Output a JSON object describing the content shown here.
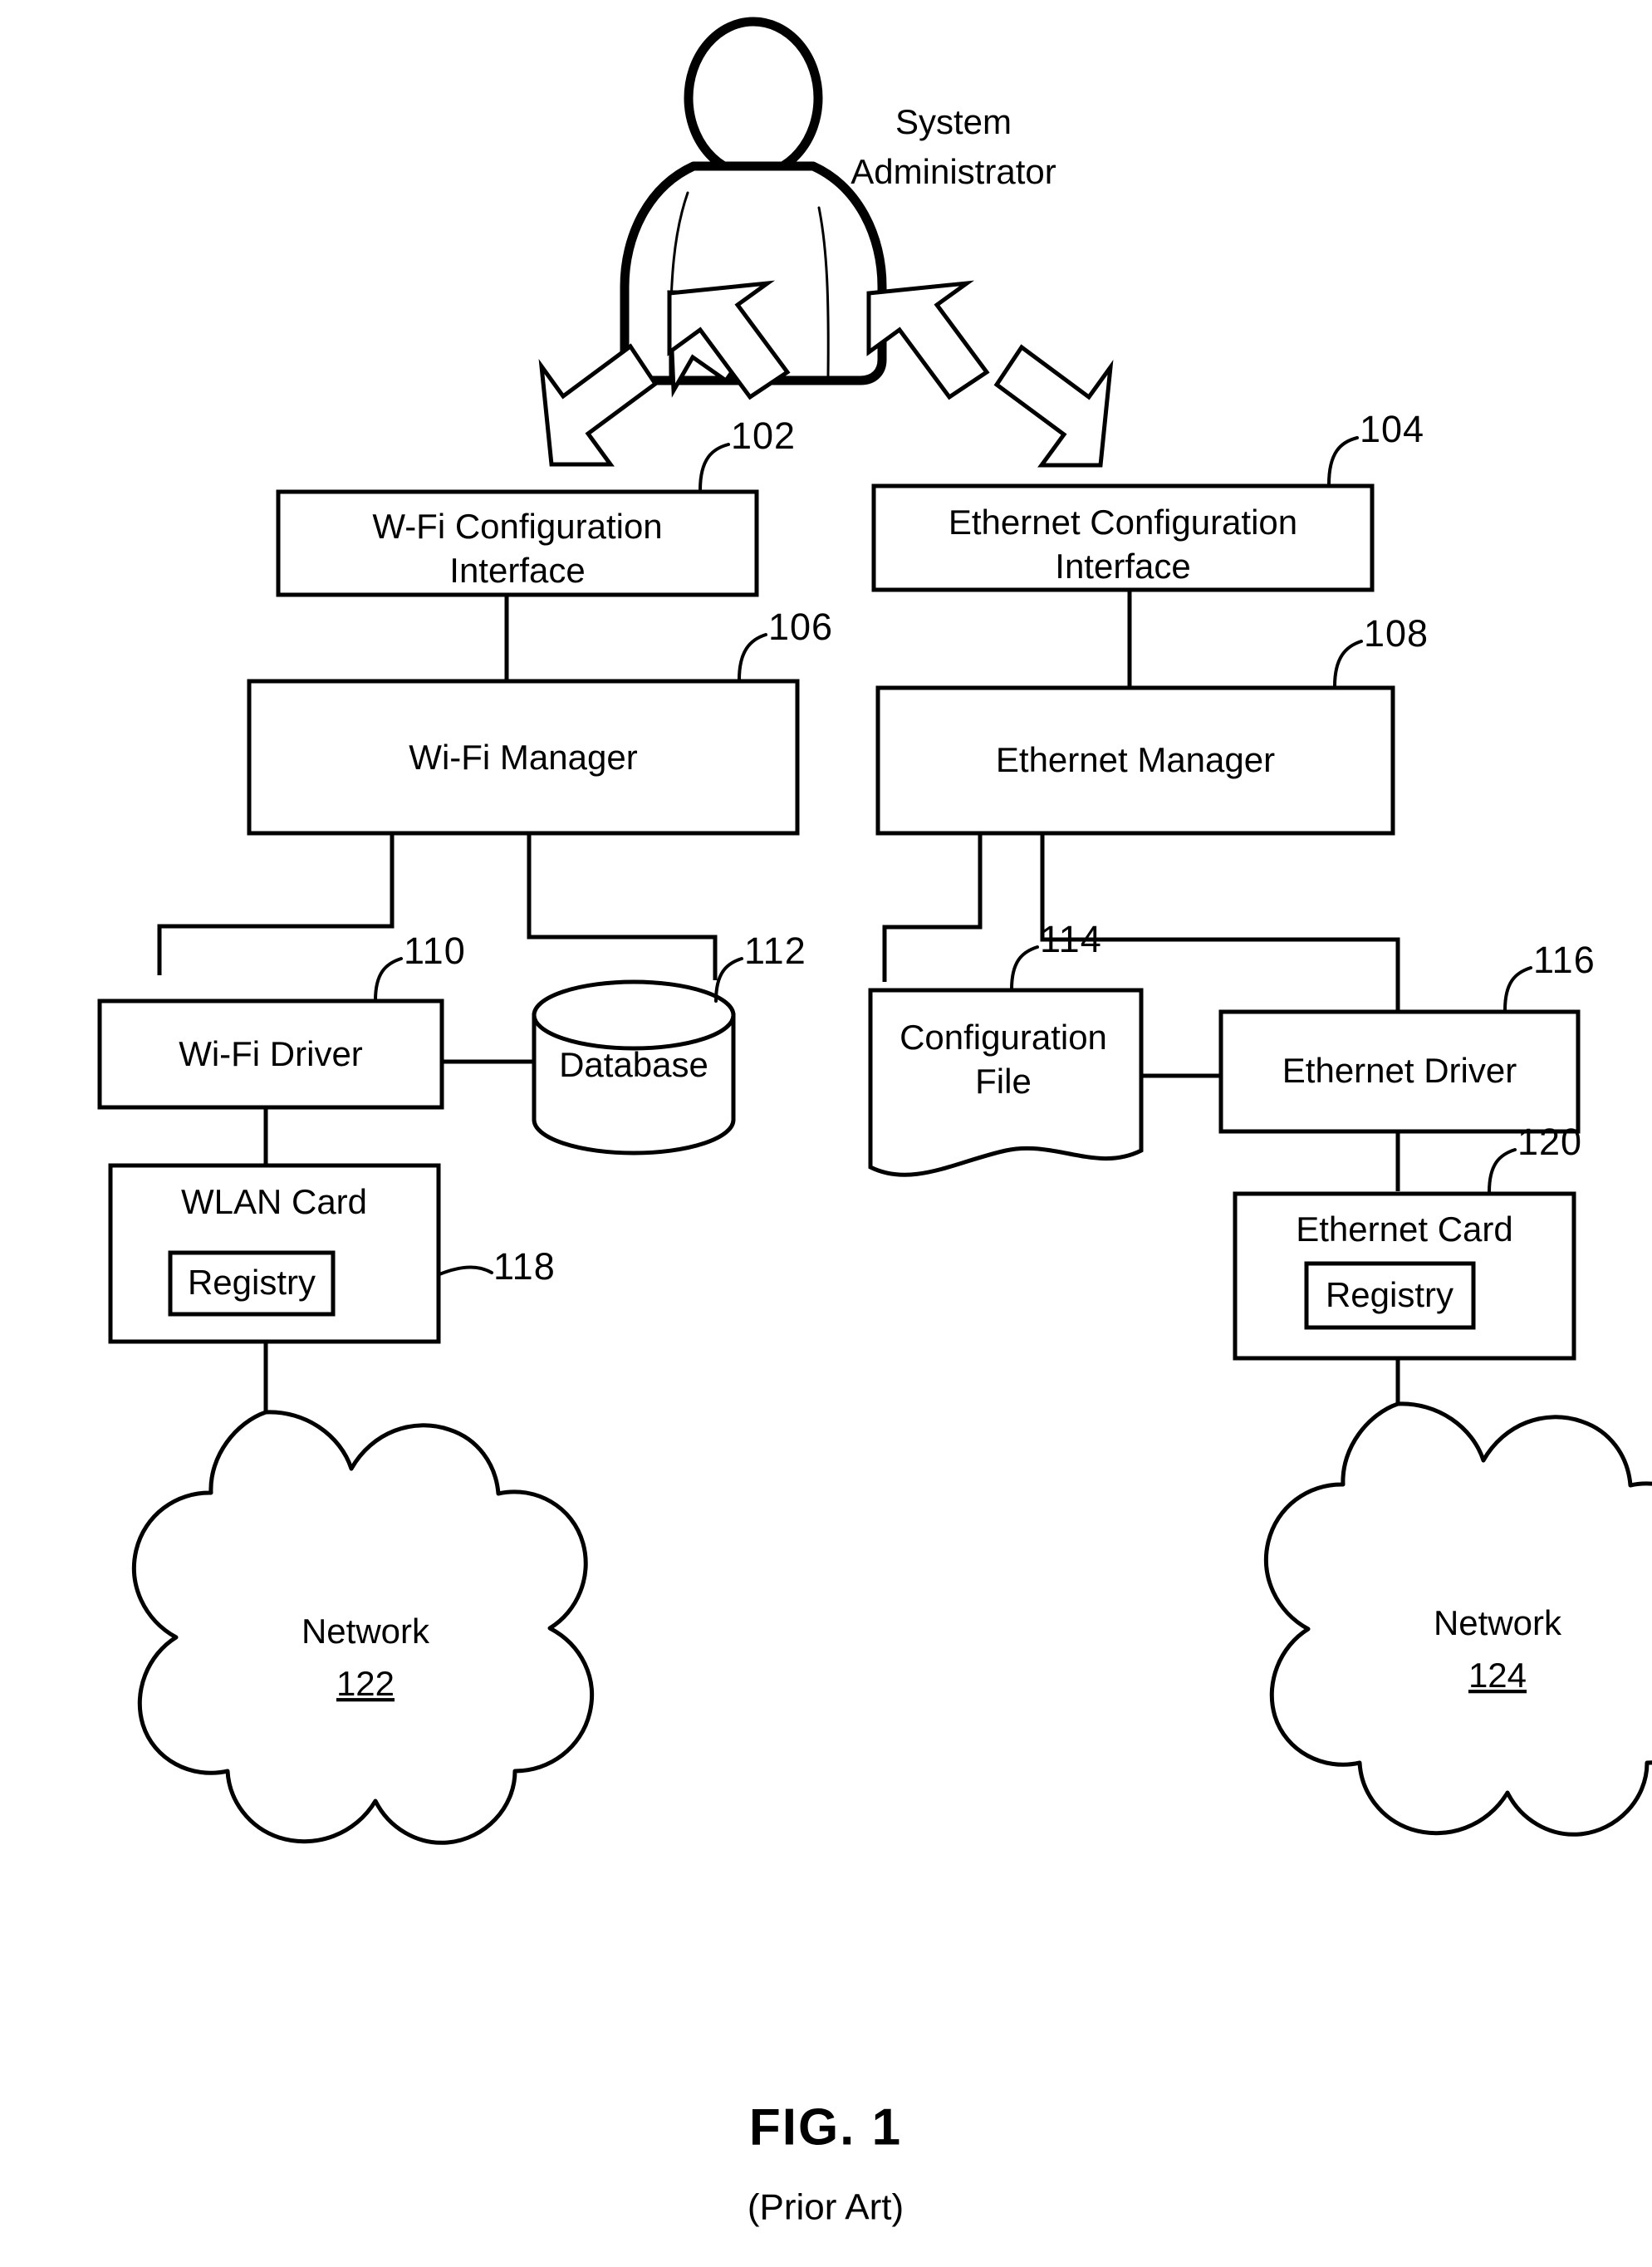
{
  "figure": {
    "caption": "FIG. 1",
    "note": "(Prior Art)"
  },
  "actor": {
    "name": "System Administrator",
    "line1": "System",
    "line2": "Administrator",
    "icon": "person-icon"
  },
  "nodes": {
    "wifi_config_interface": {
      "line1": "W-Fi Configuration",
      "line2": "Interface",
      "ref": "102",
      "shape": "rectangle"
    },
    "ethernet_config_interface": {
      "line1": "Ethernet Configuration",
      "line2": "Interface",
      "ref": "104",
      "shape": "rectangle"
    },
    "wifi_manager": {
      "line1": "Wi-Fi Manager",
      "ref": "106",
      "shape": "rectangle"
    },
    "ethernet_manager": {
      "line1": "Ethernet Manager",
      "ref": "108",
      "shape": "rectangle"
    },
    "wifi_driver": {
      "line1": "Wi-Fi Driver",
      "ref": "110",
      "shape": "rectangle"
    },
    "database": {
      "line1": "Database",
      "ref": "112",
      "shape": "cylinder"
    },
    "configuration_file": {
      "line1": "Configuration",
      "line2": "File",
      "ref": "114",
      "shape": "document"
    },
    "ethernet_driver": {
      "line1": "Ethernet Driver",
      "ref": "116",
      "shape": "rectangle"
    },
    "wlan_card": {
      "line1": "WLAN Card",
      "ref": "118",
      "shape": "rectangle",
      "inner_label": "Registry"
    },
    "ethernet_card": {
      "line1": "Ethernet Card",
      "ref": "120",
      "shape": "rectangle",
      "inner_label": "Registry"
    },
    "network_left": {
      "line1": "Network",
      "number": "122",
      "shape": "cloud"
    },
    "network_right": {
      "line1": "Network",
      "number": "124",
      "shape": "cloud"
    }
  },
  "colors": {
    "ink": "#000000",
    "paper": "#ffffff"
  }
}
